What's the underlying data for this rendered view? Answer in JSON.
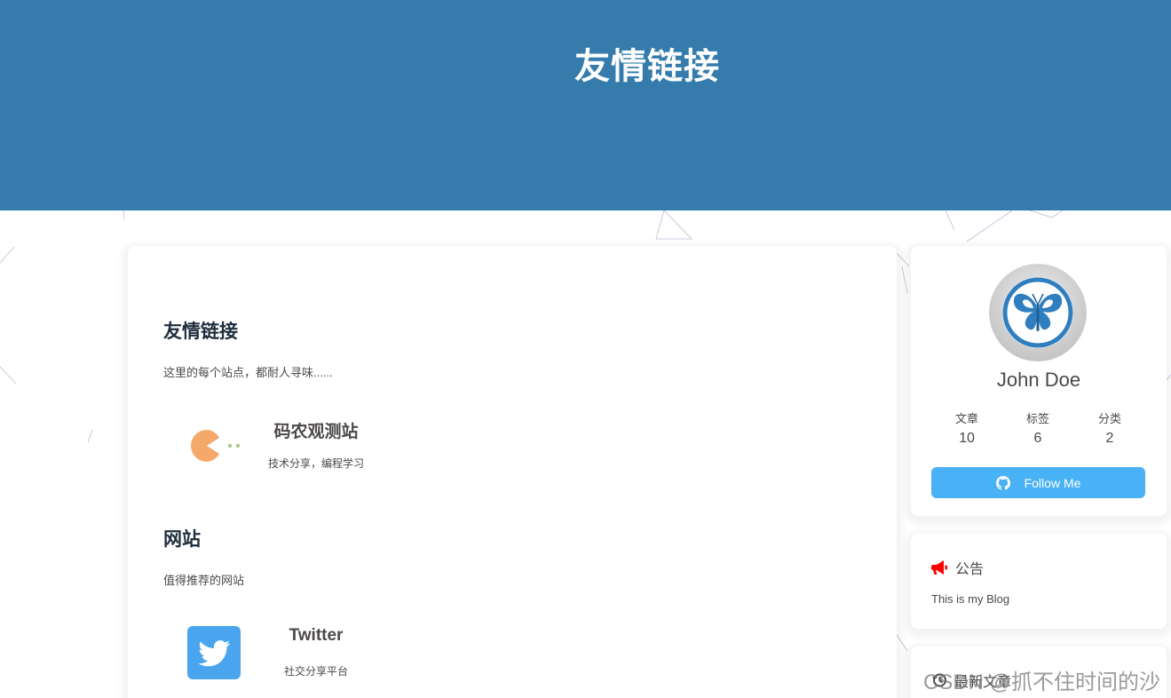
{
  "header": {
    "title": "友情链接"
  },
  "main": {
    "sections": [
      {
        "title": "友情链接",
        "description": "这里的每个站点，都耐人寻味......",
        "links": [
          {
            "name": "码农观测站",
            "description": "技术分享，编程学习",
            "icon": "pacman-loading-icon"
          }
        ]
      },
      {
        "title": "网站",
        "description": "值得推荐的网站",
        "links": [
          {
            "name": "Twitter",
            "description": "社交分享平台",
            "icon": "twitter-icon"
          }
        ]
      }
    ]
  },
  "sidebar": {
    "author": {
      "name": "John Doe",
      "avatar_icon": "butterfly-icon",
      "stats": [
        {
          "label": "文章",
          "value": "10"
        },
        {
          "label": "标签",
          "value": "6"
        },
        {
          "label": "分类",
          "value": "2"
        }
      ],
      "follow_label": "Follow Me"
    },
    "announcement": {
      "heading": "公告",
      "text": "This is my Blog"
    },
    "recent": {
      "heading": "最新文章"
    }
  },
  "watermark": "CSDN @抓不住时间的沙",
  "colors": {
    "header_bg": "#357cac",
    "accent": "#49b1f5",
    "announce_icon": "#ff0000",
    "twitter": "#4aa5ee",
    "pacman": "#f4a96a"
  }
}
